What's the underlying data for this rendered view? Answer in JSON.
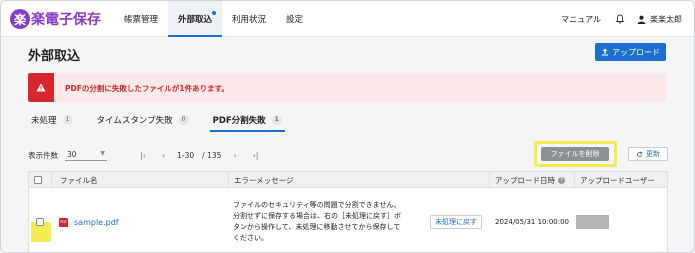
{
  "brand": {
    "mark": "楽",
    "name": "楽電子保存",
    "color": "#8a3cc7"
  },
  "nav": {
    "items": [
      {
        "label": "帳票管理"
      },
      {
        "label": "外部取込"
      },
      {
        "label": "利用状況"
      },
      {
        "label": "設定"
      }
    ],
    "active": "外部取込"
  },
  "header_right": {
    "manual": "マニュアル",
    "user": "楽楽太郎"
  },
  "page": {
    "title": "外部取込",
    "upload_label": "アップロード"
  },
  "alert": {
    "message": "PDFの分割に失敗したファイルが1件あります。"
  },
  "tabs": [
    {
      "label": "未処理",
      "count": "1"
    },
    {
      "label": "タイムスタンプ失敗",
      "count": "0"
    },
    {
      "label": "PDF分割失敗",
      "count": "1"
    }
  ],
  "pagination": {
    "per_page_label": "表示件数",
    "per_page_value": "30",
    "range": "1-30",
    "total": "/ 135"
  },
  "toolbar": {
    "delete_label": "ファイルを削除",
    "refresh_label": "更新"
  },
  "table": {
    "headers": {
      "file": "ファイル名",
      "error": "エラーメッセージ",
      "date": "アップロード日時",
      "user": "アップロードユーザー"
    },
    "rows": [
      {
        "file": "sample.pdf",
        "error_lines": [
          "ファイルのセキュリティ等の問題で分割できません。",
          "分割せずに保存する場合は、右の［未処理に戻す］ボ",
          "タンから操作して、未処理に移動させてから保存して",
          "ください。"
        ],
        "action": "未処理に戻す",
        "date": "2024/05/31 10:00:00"
      }
    ]
  },
  "colors": {
    "accent": "#1b6fce",
    "danger": "#d7262d",
    "highlight": "#f5ec54"
  }
}
